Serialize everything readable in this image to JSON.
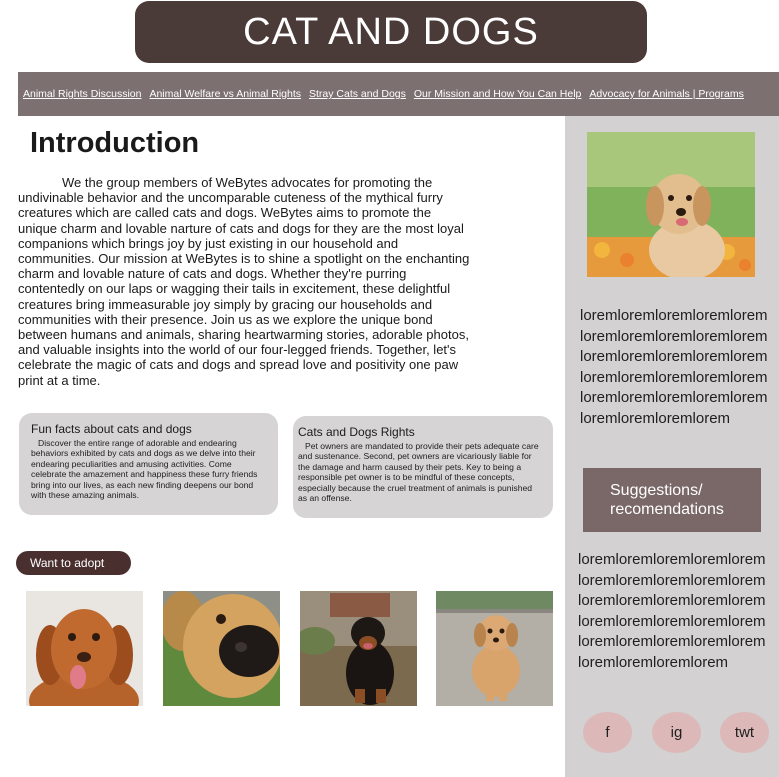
{
  "header": {
    "title": "CAT AND DOGS"
  },
  "nav": {
    "links": [
      "Animal Rights Discussion ",
      "Animal Welfare vs Animal Rights",
      "Stray Cats and Dogs",
      "Our Mission and How You Can Help",
      "Advocacy for Animals | Programs"
    ]
  },
  "intro": {
    "heading": "Introduction",
    "body": "We the group members of WeBytes advocates for promoting the undivinable behavior and the uncomparable cuteness of the mythical furry creatures which are called cats and dogs. WeBytes aims to promote the unique charm and lovable narture of cats and dogs for they are the most loyal companions which brings joy by just existing in our household and communities. Our mission at WeBytes is to shine a spotlight on the enchanting charm and lovable nature of cats and dogs. Whether they're purring contentedly on our laps or wagging their tails in excitement, these delightful creatures bring immeasurable joy simply by gracing our households and communities with their presence. Join us as we explore the unique bond between humans and animals, sharing heartwarming stories, adorable photos, and valuable insights into the world of our four-legged friends. Together, let's celebrate the magic of cats and dogs and spread love and positivity one paw print at a time."
  },
  "cards": [
    {
      "title": "Fun facts about cats and dogs",
      "body": "Discover the entire range of adorable and endearing behaviors exhibited by cats and dogs as we delve into their endearing peculiarities and amusing activities. Come celebrate the amazement and happiness these furry friends bring into our lives, as each new finding deepens our bond with these amazing animals."
    },
    {
      "title": "Cats and Dogs Rights",
      "body": "Pet owners are mandated to provide their pets adequate care and sustenance. Second, pet owners are vicariously liable for the damage and harm caused by their pets. Key to being a responsible pet owner is to be mindful of these concepts, especially because the cruel treatment of animals is punished as an offense."
    }
  ],
  "adopt": {
    "label": "Want to adopt"
  },
  "sidebar": {
    "lorem1": "loremloremloremloremloremloremloremloremloremloremloremloremloremloremloremloremloremloremloremloremloremloremloremloremloremloremloremloremlorem",
    "suggest_label": "Suggestions/ recomendations",
    "lorem2": "loremloremloremloremloremloremloremloremloremloremloremloremloremloremloremloremloremloremloremloremloremloremloremloremloremloremloremloremlorem",
    "social": [
      "f",
      "ig",
      "twt"
    ]
  },
  "colors": {
    "title_bg": "#4a3a38",
    "nav_bg": "#7d7070",
    "sidebar_bg": "#d3d1d1",
    "suggest_bg": "#7a6868",
    "social_bg": "#dcb8b8",
    "adopt_bg": "#4a2f2f",
    "card_bg": "#d6d4d4"
  }
}
